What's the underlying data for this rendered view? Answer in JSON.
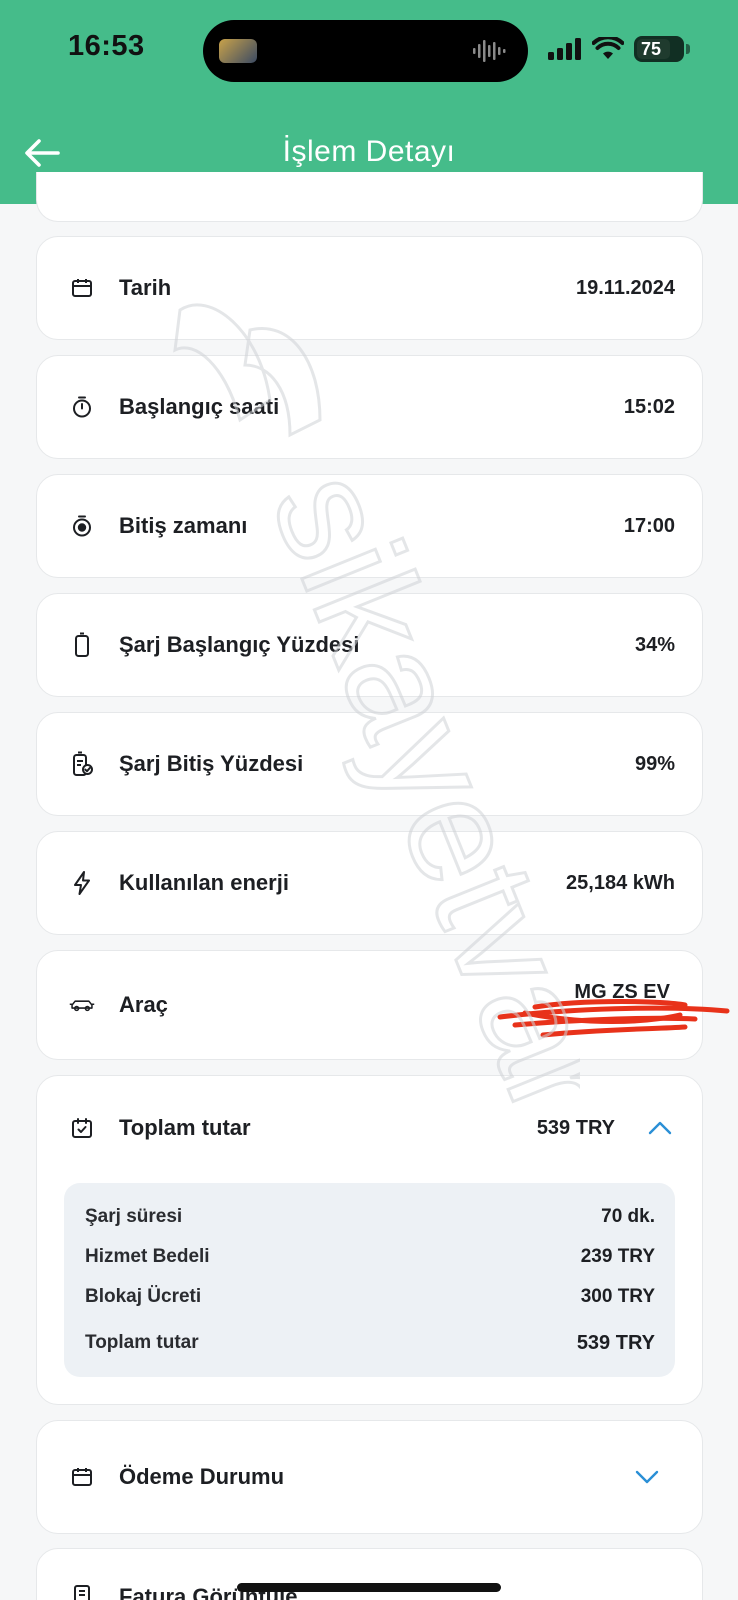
{
  "status_bar": {
    "time": "16:53",
    "battery": "75",
    "battery_level": 0.75
  },
  "header": {
    "title": "İşlem Detayı"
  },
  "details": [
    {
      "icon": "calendar-icon",
      "label": "Tarih",
      "value": "19.11.2024"
    },
    {
      "icon": "stopwatch-icon",
      "label": "Başlangıç saati",
      "value": "15:02"
    },
    {
      "icon": "stopwatch-stop-icon",
      "label": "Bitiş zamanı",
      "value": "17:00"
    },
    {
      "icon": "battery-icon",
      "label": "Şarj Başlangıç Yüzdesi",
      "value": "34%"
    },
    {
      "icon": "battery-check-icon",
      "label": "Şarj Bitiş Yüzdesi",
      "value": "99%"
    },
    {
      "icon": "lightning-icon",
      "label": "Kullanılan enerji",
      "value": "25,184 kWh"
    }
  ],
  "vehicle": {
    "label": "Araç",
    "value": "MG ZS EV"
  },
  "total": {
    "label": "Toplam tutar",
    "value": "539 TRY",
    "breakdown": [
      {
        "label": "Şarj süresi",
        "value": "70 dk."
      },
      {
        "label": "Hizmet Bedeli",
        "value": "239 TRY"
      },
      {
        "label": "Blokaj Ücreti",
        "value": "300 TRY"
      }
    ],
    "total_row": {
      "label": "Toplam tutar",
      "value": "539 TRY"
    }
  },
  "payment": {
    "label": "Ödeme Durumu"
  },
  "invoice": {
    "label": "Fatura Görüntüle"
  },
  "watermark": {
    "text": "sikayetvar"
  },
  "colors": {
    "header_green": "#45bc8a",
    "chevron_blue": "#2a8fd6",
    "breakdown_bg": "#edf1f5",
    "redaction_red": "#e8321a"
  }
}
